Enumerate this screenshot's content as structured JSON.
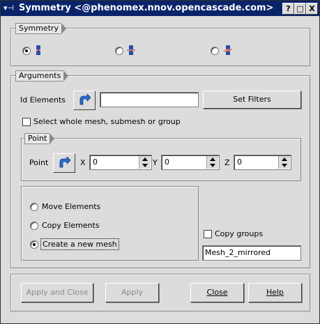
{
  "window": {
    "title": "Symmetry <@phenomex.nnov.opencascade.com>",
    "buttons": {
      "help": "?",
      "maximize": "□",
      "close": "X"
    }
  },
  "symmetry": {
    "label": "Symmetry",
    "options": [
      {
        "name": "point-symmetry",
        "selected": true
      },
      {
        "name": "axis-symmetry",
        "selected": false
      },
      {
        "name": "plane-symmetry",
        "selected": false
      }
    ]
  },
  "arguments": {
    "label": "Arguments",
    "id_elements_label": "Id Elements",
    "id_elements_value": "",
    "set_filters_label": "Set Filters",
    "select_whole_label": "Select whole mesh, submesh or group",
    "point": {
      "group_label": "Point",
      "label": "Point",
      "x_label": "X",
      "x_value": "0",
      "y_label": "Y",
      "y_value": "0",
      "z_label": "Z",
      "z_value": "0"
    },
    "actions": [
      {
        "label": "Move Elements",
        "selected": false
      },
      {
        "label": "Copy Elements",
        "selected": false
      },
      {
        "label": "Create a new mesh",
        "selected": true
      }
    ],
    "copy_groups_label": "Copy groups",
    "new_mesh_name": "Mesh_2_mirrored"
  },
  "footer": {
    "apply_close": "Apply and Close",
    "apply": "Apply",
    "close": "Close",
    "help": "Help"
  },
  "colors": {
    "titlebar": "#0a246a",
    "background": "#dcdcdc",
    "icon_blue": "#2a6ec8"
  }
}
